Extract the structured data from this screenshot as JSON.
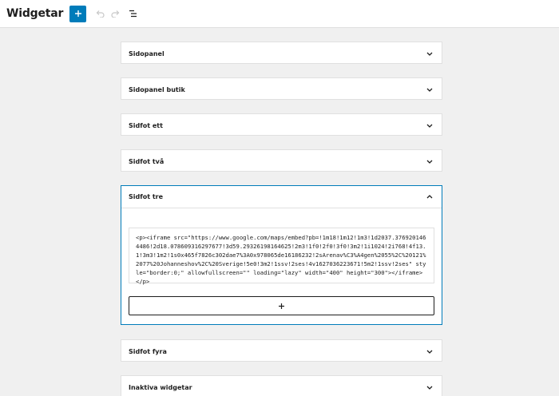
{
  "header": {
    "title": "Widgetar",
    "icons": {
      "add": "plus-icon",
      "undo": "undo-icon",
      "redo": "redo-icon",
      "list_view": "list-view-icon"
    }
  },
  "areas": [
    {
      "title": "Sidopanel"
    },
    {
      "title": "Sidopanel butik"
    },
    {
      "title": "Sidfot ett"
    },
    {
      "title": "Sidfot två"
    },
    {
      "title": "Sidfot tre"
    },
    {
      "title": "Sidfot fyra"
    },
    {
      "title": "Inaktiva widgetar"
    }
  ],
  "open_area": {
    "code": "<p><iframe src=\"https://www.google.com/maps/embed?pb=!1m18!1m12!1m3!1d2037.3769201464486!2d18.078609316297677!3d59.29326198164625!2m3!1f0!2f0!3f0!3m2!1i1024!2i768!4f13.1!3m3!1m2!1s0x465f7826c302dae7%3A0x978065de16186232!2sArenav%C3%A4gen%2055%2C%20121%2077%20Johanneshov%2C%20Sverige!5e0!3m2!1ssv!2ses!4v1627036223671!5m2!1ssv!2ses\" style=\"border:0;\" allowfullscreen=\"\" loading=\"lazy\" width=\"400\" height=\"300\"></iframe></p>"
  },
  "colors": {
    "accent": "#007cba",
    "background": "#f0f0f0"
  }
}
